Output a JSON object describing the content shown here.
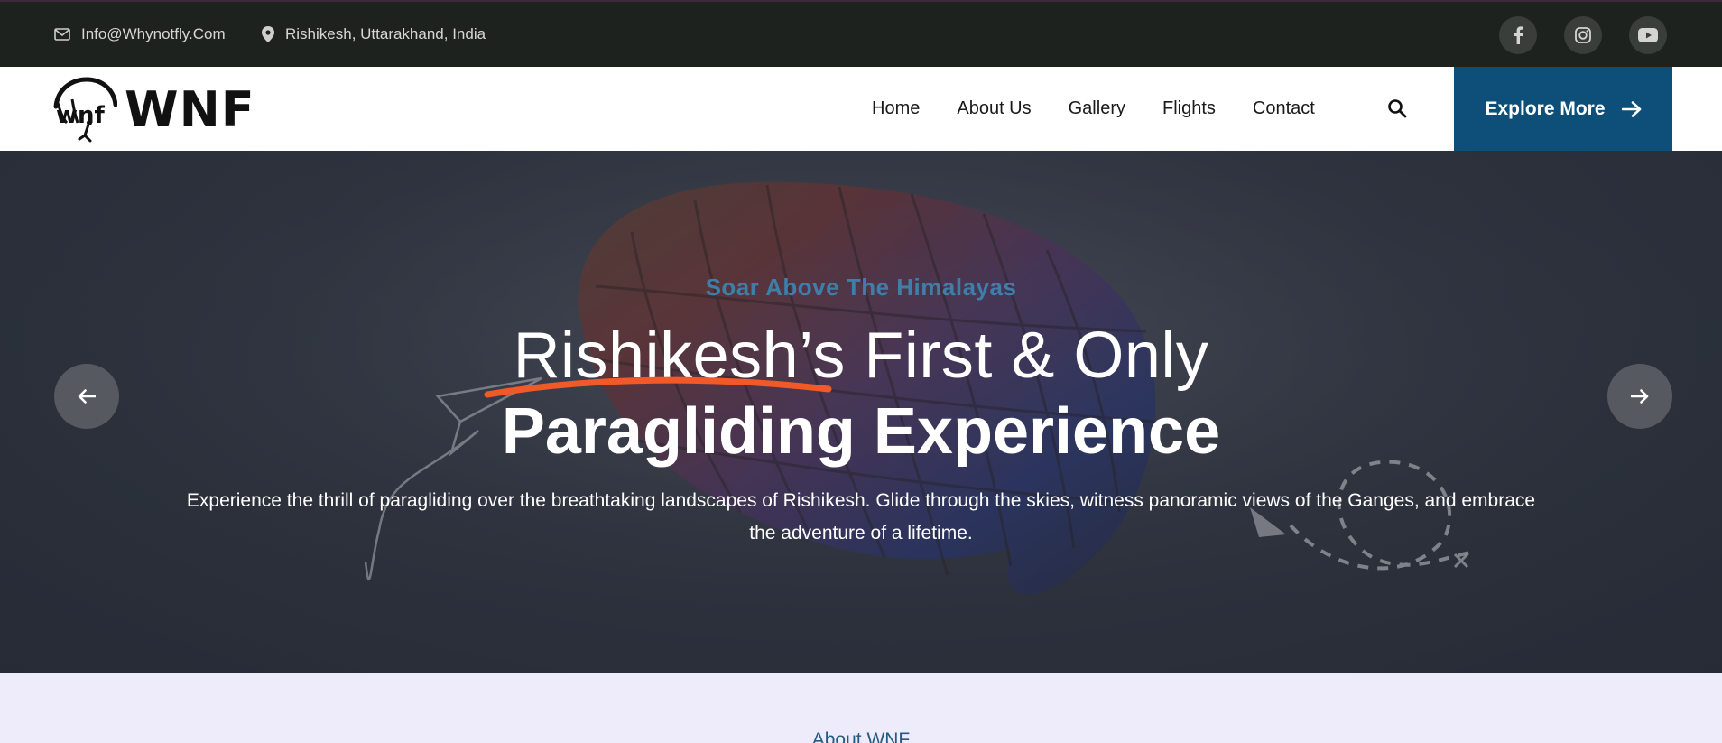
{
  "topbar": {
    "email": "Info@Whynotfly.Com",
    "location": "Rishikesh, Uttarakhand, India",
    "social": [
      "facebook-icon",
      "instagram-icon",
      "youtube-icon"
    ]
  },
  "nav": {
    "logo_text": "WNF",
    "items": [
      {
        "label": "Home"
      },
      {
        "label": "About Us"
      },
      {
        "label": "Gallery"
      },
      {
        "label": "Flights"
      },
      {
        "label": "Contact"
      }
    ],
    "cta_label": "Explore More"
  },
  "hero": {
    "eyebrow": "Soar Above The Himalayas",
    "title_line1": "Rishikesh’s First & Only",
    "title_line2": "Paragliding Experience",
    "description": "Experience the thrill of paragliding over the breathtaking landscapes of Rishikesh. Glide through the skies, witness panoramic views of the Ganges, and embrace the adventure of a lifetime."
  },
  "about": {
    "label": "About WNF"
  },
  "colors": {
    "topbar_bg": "#1e221f",
    "cta_bg": "#0d4f78",
    "eyebrow": "#3e7ea8",
    "underline": "#f05a28",
    "section_bg": "#eeecfa"
  }
}
